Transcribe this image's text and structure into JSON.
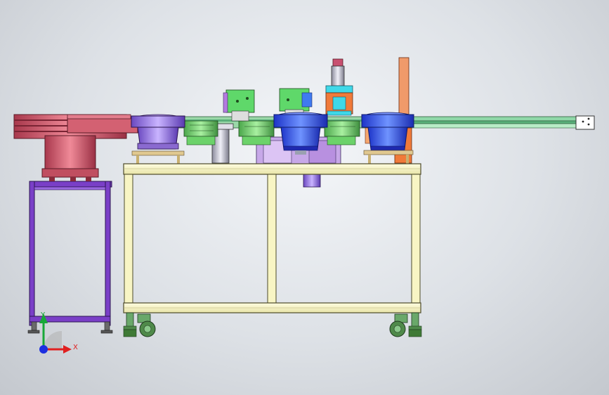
{
  "viewport": {
    "background_top": "#f4f6f9",
    "background_edge": "#c4c8ce"
  },
  "triad": {
    "x_label": "X",
    "y_label": "Y",
    "x_color": "#e02020",
    "y_color": "#18a838",
    "z_color": "#1c2fe0"
  },
  "colors": {
    "table_frame": "#f8f5c4",
    "table_outline": "#4d4a2a",
    "stand_frame": "#7a3fc7",
    "red_feeder": "#d36172",
    "purple_bowl": "#9a7ae0",
    "blue_bowl": "#3a62f0",
    "green_parts": "#6cd26a",
    "conveyor": "#7fcf9a",
    "orange_parts": "#f07a3a",
    "cyan_parts": "#3fd8e8",
    "wheel_green": "#3f7a36"
  }
}
